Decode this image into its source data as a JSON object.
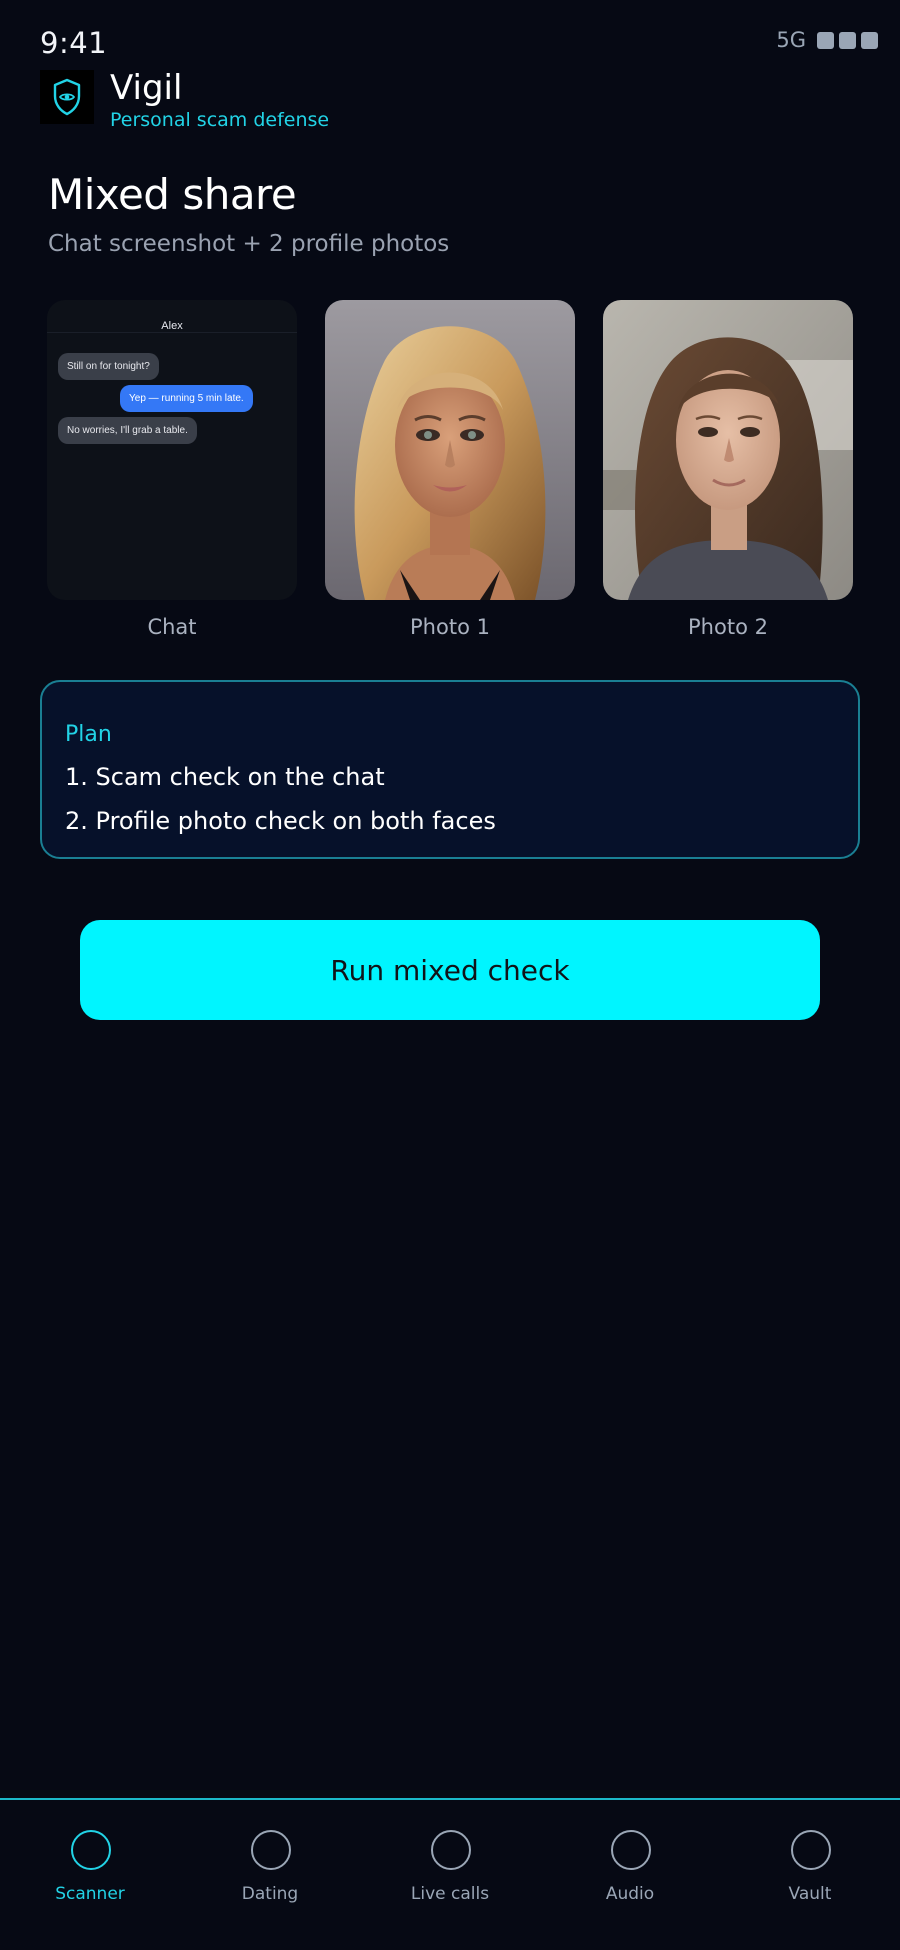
{
  "status_bar": {
    "time": "9:41",
    "network": "5G"
  },
  "app": {
    "name": "Vigil",
    "tagline": "Personal scam defense",
    "logo_icon": "shield-eye-icon"
  },
  "page": {
    "title": "Mixed share",
    "subtitle": "Chat screenshot + 2 profile photos"
  },
  "attachments": [
    {
      "label": "Chat",
      "chat": {
        "contact": "Alex",
        "messages": [
          {
            "from": "them",
            "text": "Still on for tonight?"
          },
          {
            "from": "me",
            "text": "Yep — running 5 min late."
          },
          {
            "from": "them",
            "text": "No worries, I'll grab a table."
          }
        ]
      }
    },
    {
      "label": "Photo 1"
    },
    {
      "label": "Photo 2"
    }
  ],
  "plan": {
    "title": "Plan",
    "steps": [
      "1. Scam check on the chat",
      "2. Profile photo check on both faces"
    ]
  },
  "actions": {
    "run_label": "Run mixed check"
  },
  "nav": {
    "items": [
      {
        "label": "Scanner",
        "active": true
      },
      {
        "label": "Dating",
        "active": false
      },
      {
        "label": "Live calls",
        "active": false
      },
      {
        "label": "Audio",
        "active": false
      },
      {
        "label": "Vault",
        "active": false
      }
    ]
  },
  "colors": {
    "background": "#060914",
    "accent": "#22d3e6",
    "button": "#00f5ff",
    "card_border": "#1a7f93",
    "card_bg": "#06112a",
    "chat_out_bubble": "#3478f6",
    "chat_in_bubble": "#3a3f49"
  }
}
